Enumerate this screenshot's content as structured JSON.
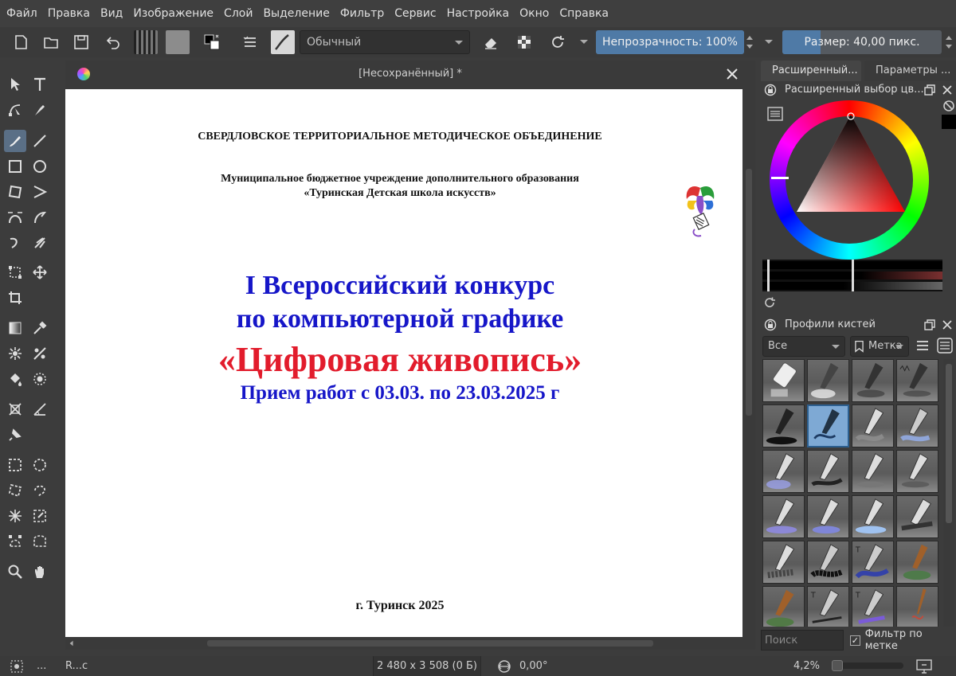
{
  "menu": [
    "Файл",
    "Правка",
    "Вид",
    "Изображение",
    "Слой",
    "Выделение",
    "Фильтр",
    "Сервис",
    "Настройка",
    "Окно",
    "Справка"
  ],
  "toolbar": {
    "blend_mode": "Обычный",
    "opacity_label": "Непрозрачность: 100%",
    "opacity_value": 100,
    "size_label": "Размер: 40,00 пикс."
  },
  "document": {
    "title": "[Несохранённый] *",
    "lines": {
      "org": "СВЕРДЛОВСКОЕ ТЕРРИТОРИАЛЬНОЕ МЕТОДИЧЕСКОЕ  ОБЪЕДИНЕНИЕ",
      "school_1": "Муниципальное бюджетное учреждение дополнительного образования",
      "school_2": "«Туринская Детская школа искусств»",
      "title_1": "I Всероссийский конкурс",
      "title_2": "по компьютерной графике",
      "title_3": "«Цифровая живопись»",
      "dates": "Прием работ с 03.03. по 23.03.2025 г",
      "footer": "г. Туринск 2025"
    },
    "colors": {
      "blue": "#1616c8",
      "red": "#e21c2c"
    }
  },
  "dockers": {
    "tabs": [
      "Расширенный...",
      "Параметры ..."
    ],
    "color_panel_title": "Расширенный выбор цв...",
    "brush_panel_title": "Профили кистей",
    "brush_filter": "Все",
    "brush_tag": "Метка",
    "search_placeholder": "Поиск",
    "filter_by_tag_label": "Фильтр по метке",
    "filter_by_tag_checked": true,
    "filter_by_tag_mark": "✓"
  },
  "statusbar": {
    "layer": "R...c",
    "dots": "...",
    "dimensions": "2 480 x 3 508 (0 Б)",
    "rotation": "0,00°",
    "zoom": "4,2%"
  }
}
